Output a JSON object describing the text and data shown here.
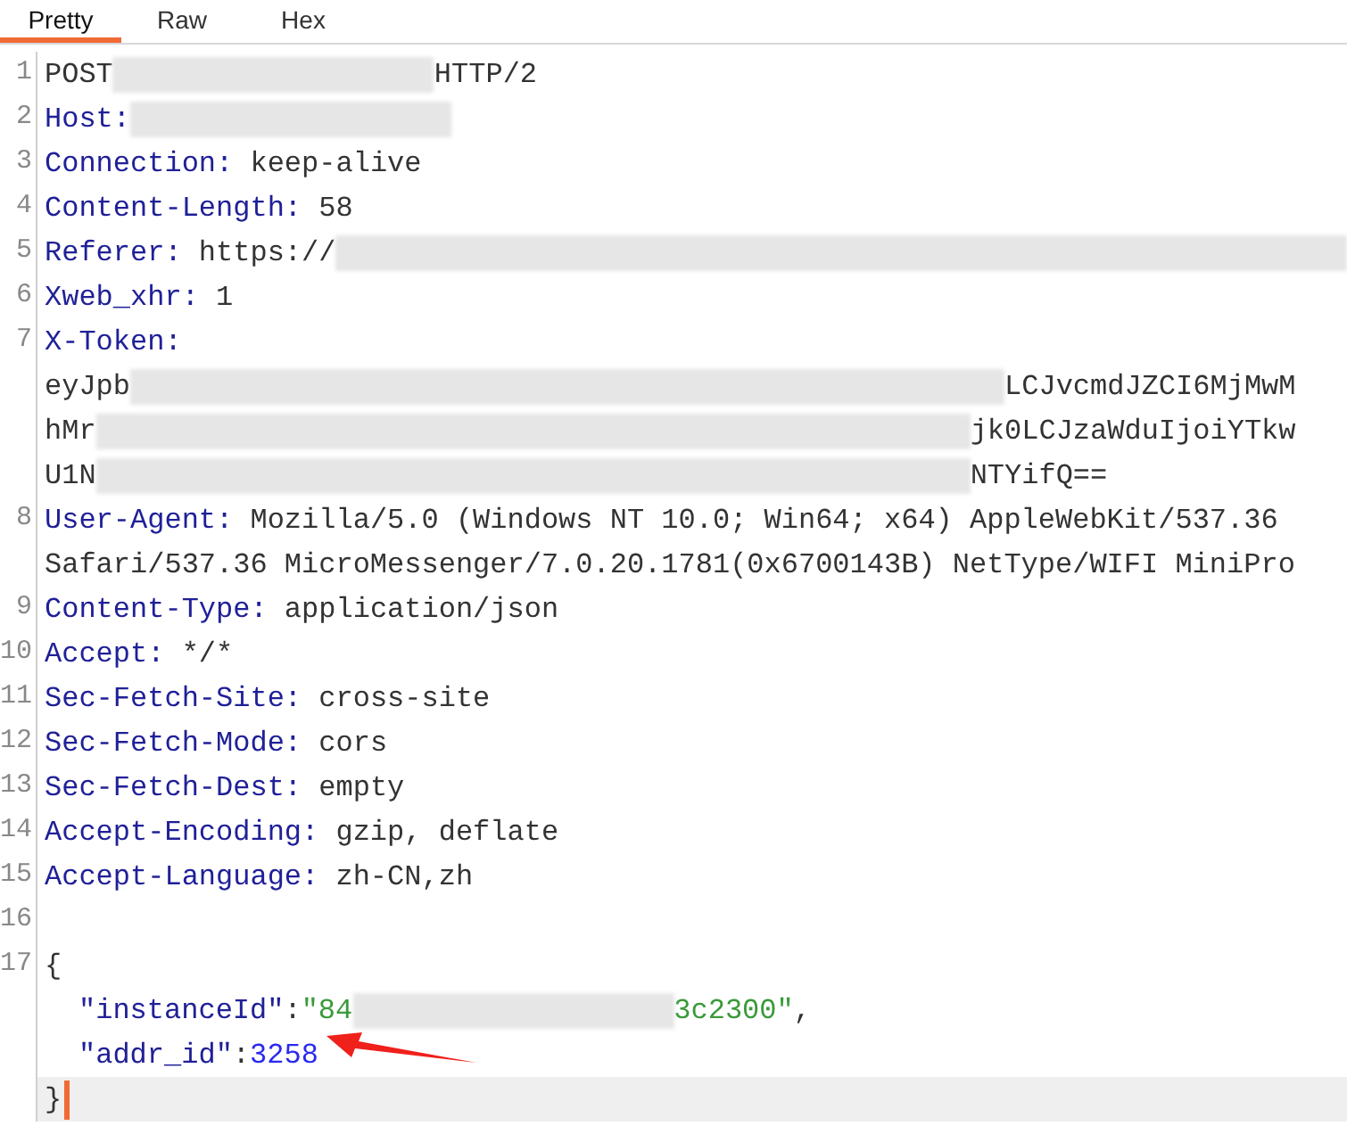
{
  "tabs": [
    {
      "label": "Pretty",
      "selected": true
    },
    {
      "label": "Raw",
      "selected": false
    },
    {
      "label": "Hex",
      "selected": false
    }
  ],
  "lines": [
    {
      "number": "1",
      "indented": false,
      "current": false,
      "segments": [
        {
          "kind": "text",
          "text": "POST"
        },
        {
          "kind": "mask"
        },
        {
          "kind": "text",
          "text": "HTTP/2"
        }
      ]
    },
    {
      "number": "2",
      "indented": false,
      "current": false,
      "segments": [
        {
          "kind": "key",
          "text": "Host:"
        },
        {
          "kind": "mask"
        }
      ]
    },
    {
      "number": "3",
      "indented": false,
      "current": false,
      "segments": [
        {
          "kind": "key",
          "text": "Connection:"
        },
        {
          "kind": "text",
          "text": " keep-alive"
        }
      ]
    },
    {
      "number": "4",
      "indented": false,
      "current": false,
      "segments": [
        {
          "kind": "key",
          "text": "Content-Length:"
        },
        {
          "kind": "text",
          "text": " 58"
        }
      ]
    },
    {
      "number": "5",
      "indented": false,
      "current": false,
      "segments": [
        {
          "kind": "key",
          "text": "Referer:"
        },
        {
          "kind": "text",
          "text": " https://"
        },
        {
          "kind": "tailmask"
        }
      ]
    },
    {
      "number": "6",
      "indented": false,
      "current": false,
      "segments": [
        {
          "kind": "key",
          "text": "Xweb_xhr:"
        },
        {
          "kind": "text",
          "text": " 1"
        }
      ]
    },
    {
      "number": "7",
      "indented": false,
      "current": false,
      "segments": [
        {
          "kind": "key",
          "text": "X-Token:"
        }
      ]
    },
    {
      "indented": false,
      "current": false,
      "segments": [
        {
          "kind": "text",
          "text": "eyJpb"
        },
        {
          "kind": "widemask"
        },
        {
          "kind": "text",
          "text": "LCJvcmdJZCI6MjMwM"
        }
      ]
    },
    {
      "indented": false,
      "current": false,
      "segments": [
        {
          "kind": "text",
          "text": "hMr"
        },
        {
          "kind": "widemask"
        },
        {
          "kind": "text",
          "text": "jk0LCJzaWduIjoiYTkw"
        }
      ]
    },
    {
      "indented": false,
      "current": false,
      "segments": [
        {
          "kind": "text",
          "text": "U1N"
        },
        {
          "kind": "widemask"
        },
        {
          "kind": "text",
          "text": "NTYifQ=="
        }
      ]
    },
    {
      "number": "8",
      "indented": false,
      "current": false,
      "segments": [
        {
          "kind": "key",
          "text": "User-Agent:"
        },
        {
          "kind": "text",
          "text": " Mozilla/5.0 (Windows NT 10.0; Win64; x64) AppleWebKit/537.36"
        }
      ]
    },
    {
      "indented": false,
      "current": false,
      "segments": [
        {
          "kind": "text",
          "text": "Safari/537.36 MicroMessenger/7.0.20.1781(0x6700143B) NetType/WIFI MiniPro"
        }
      ]
    },
    {
      "number": "9",
      "indented": false,
      "current": false,
      "segments": [
        {
          "kind": "key",
          "text": "Content-Type:"
        },
        {
          "kind": "text",
          "text": " application/json"
        }
      ]
    },
    {
      "number": "10",
      "indented": false,
      "current": false,
      "segments": [
        {
          "kind": "key",
          "text": "Accept:"
        },
        {
          "kind": "text",
          "text": " */*"
        }
      ]
    },
    {
      "number": "11",
      "indented": false,
      "current": false,
      "segments": [
        {
          "kind": "key",
          "text": "Sec-Fetch-Site:"
        },
        {
          "kind": "text",
          "text": " cross-site"
        }
      ]
    },
    {
      "number": "12",
      "indented": false,
      "current": false,
      "segments": [
        {
          "kind": "key",
          "text": "Sec-Fetch-Mode:"
        },
        {
          "kind": "text",
          "text": " cors"
        }
      ]
    },
    {
      "number": "13",
      "indented": false,
      "current": false,
      "segments": [
        {
          "kind": "key",
          "text": "Sec-Fetch-Dest:"
        },
        {
          "kind": "text",
          "text": " empty"
        }
      ]
    },
    {
      "number": "14",
      "indented": false,
      "current": false,
      "segments": [
        {
          "kind": "key",
          "text": "Accept-Encoding:"
        },
        {
          "kind": "text",
          "text": " gzip, deflate"
        }
      ]
    },
    {
      "number": "15",
      "indented": false,
      "current": false,
      "segments": [
        {
          "kind": "key",
          "text": "Accept-Language:"
        },
        {
          "kind": "text",
          "text": " zh-CN,zh"
        }
      ]
    },
    {
      "number": "16",
      "current": false
    },
    {
      "number": "17",
      "indented": false,
      "current": false,
      "segments": [
        {
          "kind": "text",
          "text": "{"
        }
      ]
    },
    {
      "indented": true,
      "current": false,
      "segments": [
        {
          "kind": "key",
          "text": "\"instanceId\""
        },
        {
          "kind": "text",
          "text": ":"
        },
        {
          "kind": "string",
          "text": "\"84"
        },
        {
          "kind": "mask"
        },
        {
          "kind": "string",
          "text": "3c2300\""
        },
        {
          "kind": "text",
          "text": ","
        }
      ]
    },
    {
      "indented": true,
      "current": false,
      "arrow": true,
      "segments": [
        {
          "kind": "key",
          "text": "\"addr_id\""
        },
        {
          "kind": "text",
          "text": ":"
        },
        {
          "kind": "number",
          "text": "3258"
        }
      ]
    },
    {
      "indented": false,
      "current": true,
      "segments": [
        {
          "kind": "text",
          "text": "}"
        }
      ]
    }
  ]
}
